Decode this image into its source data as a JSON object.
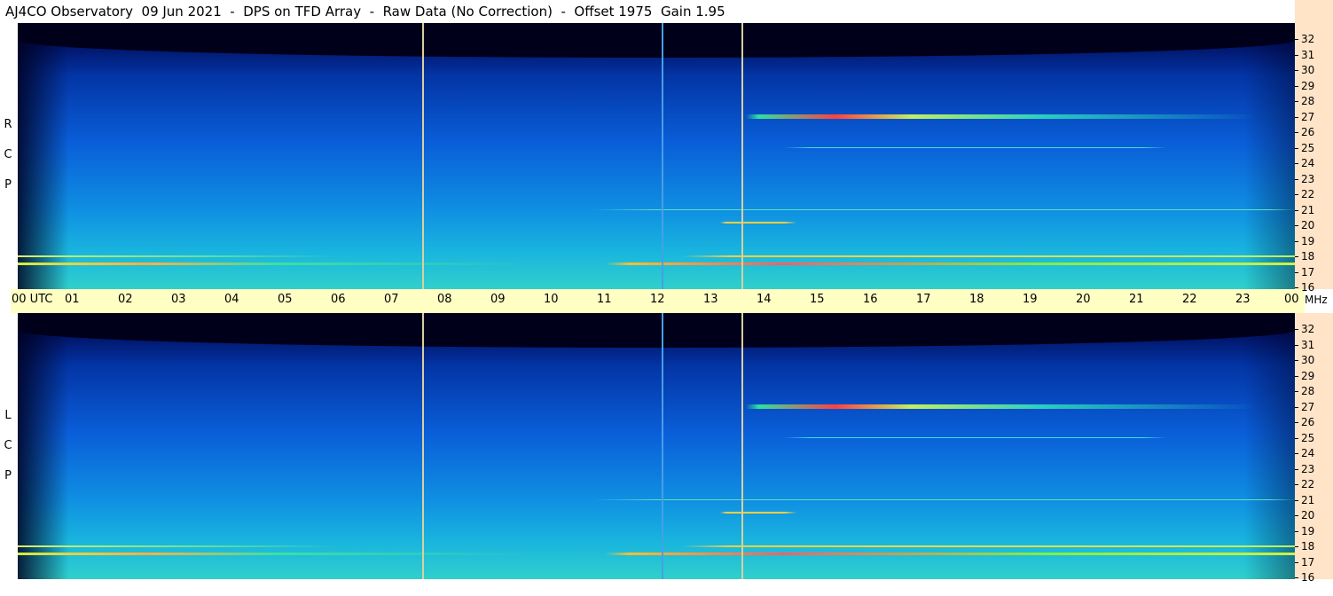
{
  "title": "AJ4CO Observatory  09 Jun 2021  -  DPS on TFD Array  -  Raw Data (No Correction)  -  Offset 1975  Gain 1.95",
  "panels": {
    "top": {
      "letters": [
        "R",
        "C",
        "P"
      ]
    },
    "bottom": {
      "letters": [
        "L",
        "C",
        "P"
      ]
    }
  },
  "utc_axis": {
    "first_label": "00  UTC",
    "labels": [
      "01",
      "02",
      "03",
      "04",
      "05",
      "06",
      "07",
      "08",
      "09",
      "10",
      "11",
      "12",
      "13",
      "14",
      "15",
      "16",
      "17",
      "18",
      "19",
      "20",
      "21",
      "22",
      "23"
    ],
    "last_label": "00",
    "unit": "MHz"
  },
  "freq_axis": {
    "labels": [
      "32",
      "31",
      "30",
      "29",
      "28",
      "27",
      "26",
      "25",
      "24",
      "23",
      "22",
      "21",
      "20",
      "19",
      "18",
      "17",
      "16"
    ]
  },
  "chart_data": {
    "type": "heatmap",
    "title": "AJ4CO Observatory  09 Jun 2021  -  DPS on TFD Array  -  Raw Data (No Correction)  -  Offset 1975  Gain 1.95",
    "x_unit": "UTC",
    "x_range": [
      0,
      24
    ],
    "y_unit": "MHz",
    "y_range": [
      16,
      32
    ],
    "panels": [
      "RCP",
      "LCP"
    ],
    "notable_vertical_lines_utc": [
      7.6,
      12.1,
      13.6
    ],
    "interference_bands_mhz": [
      27,
      17.5,
      18,
      20.2,
      21,
      25
    ],
    "colors": {
      "low": "#00001e",
      "mid": "#0a5ed8",
      "high": "#30d0cc",
      "peak": "#ff3030"
    }
  }
}
